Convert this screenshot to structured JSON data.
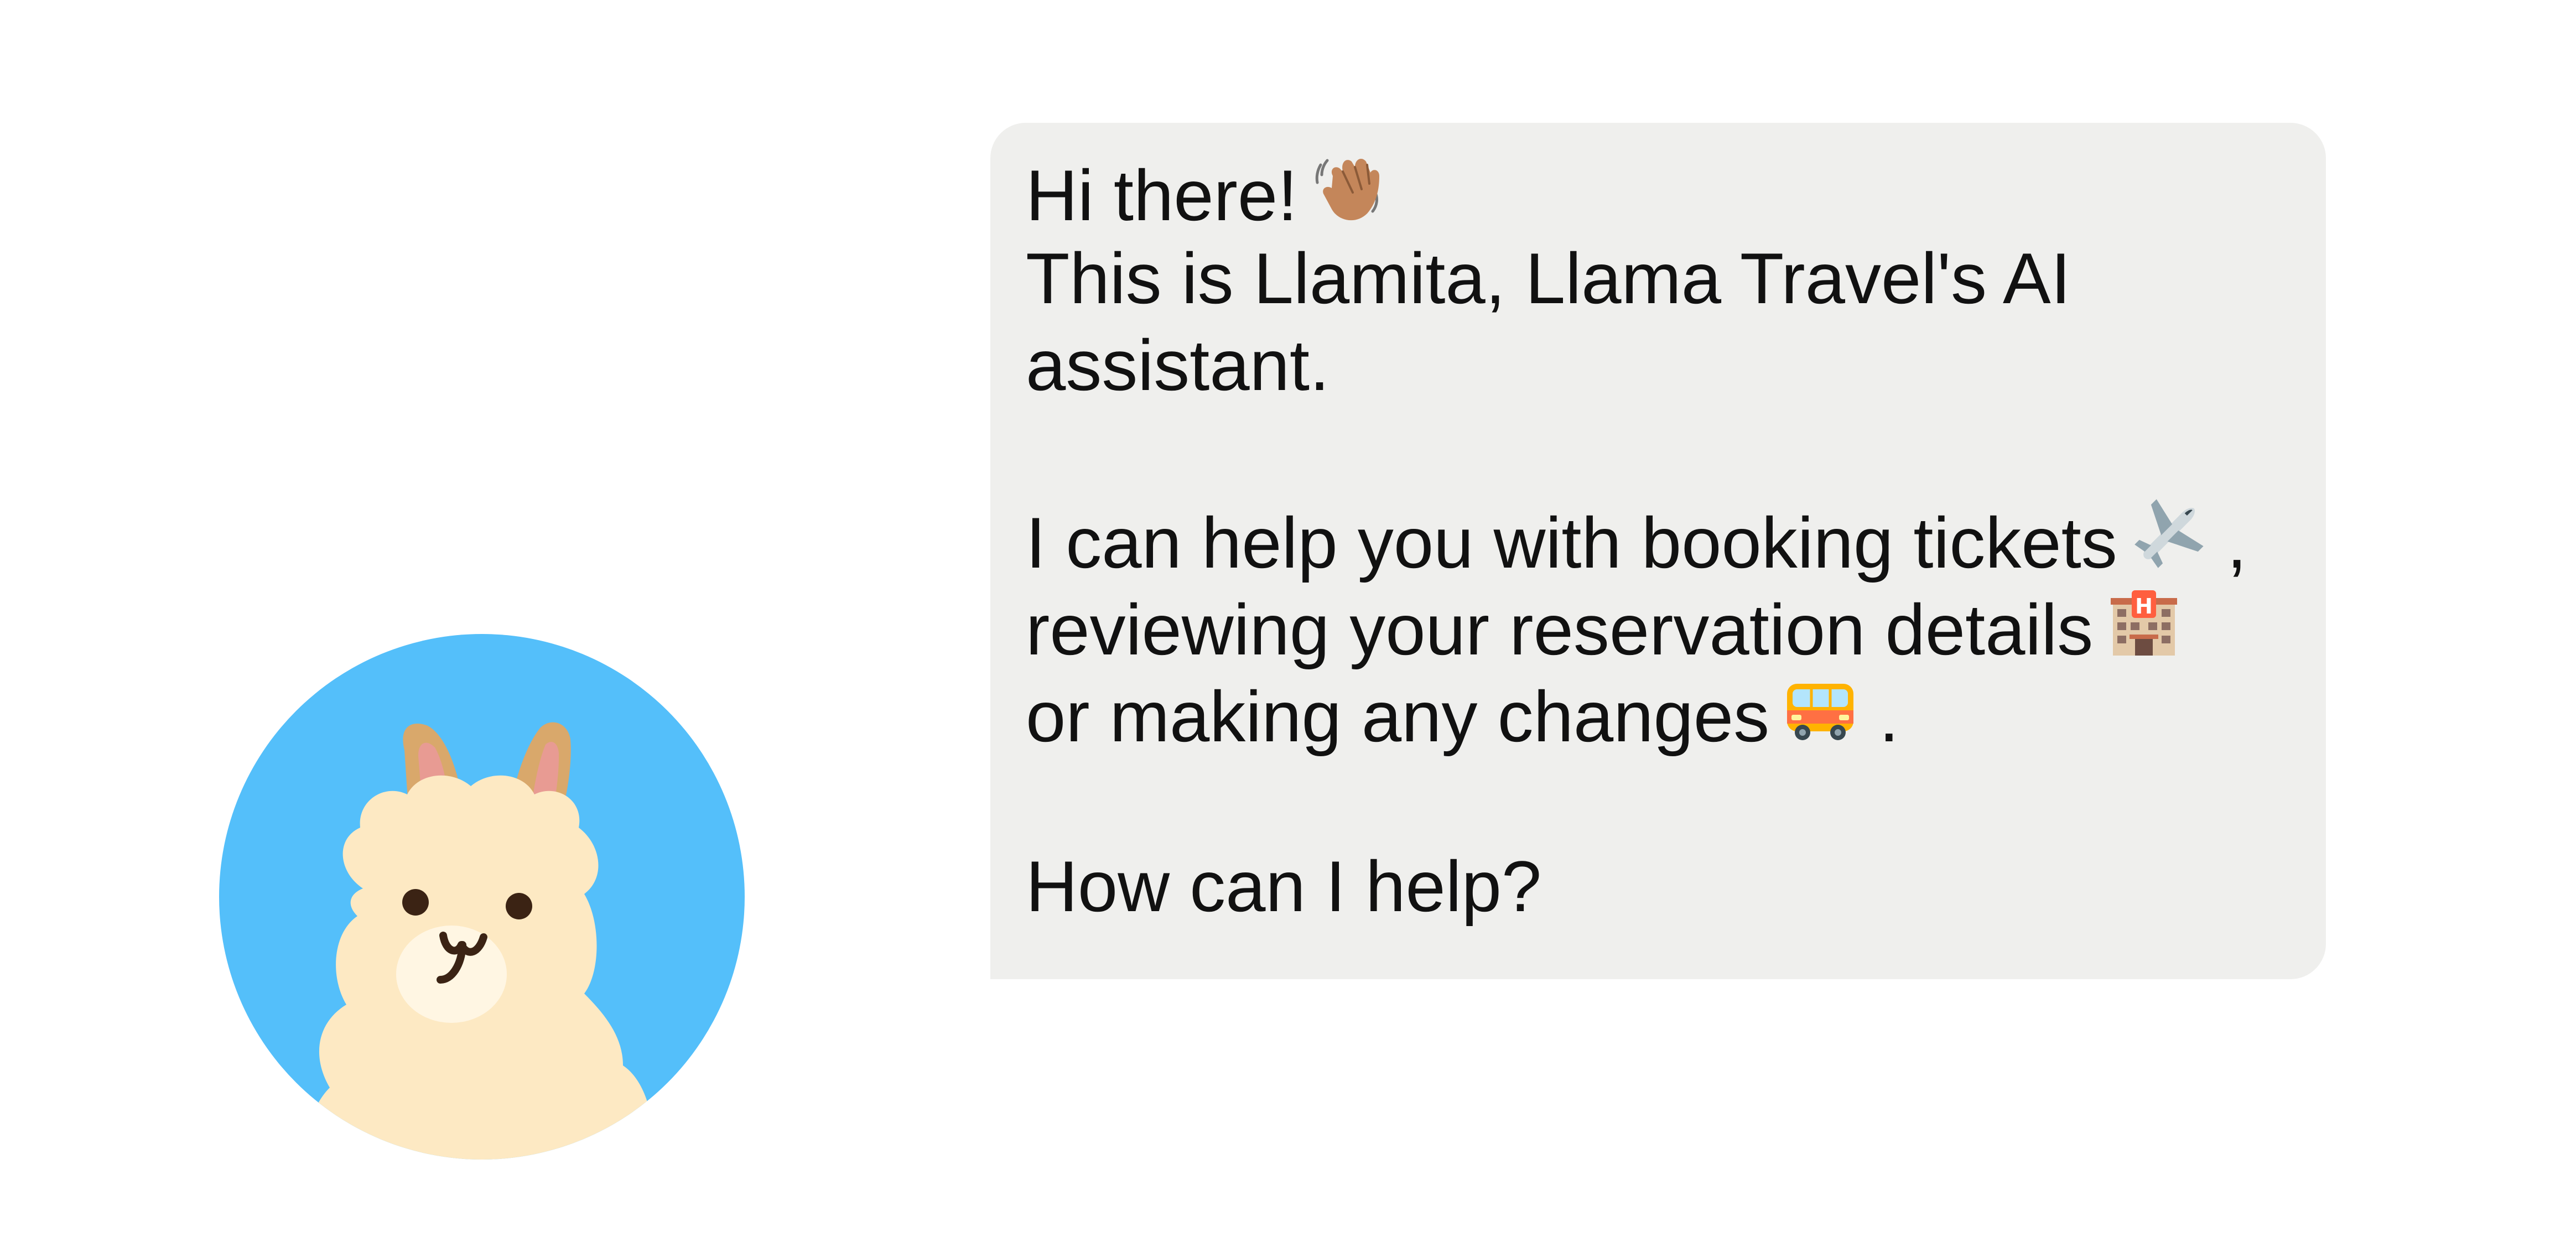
{
  "assistant": {
    "avatar_icon": "llama-avatar-icon",
    "avatar_bg_color": "#54bffa"
  },
  "message": {
    "greeting": "Hi there!",
    "greeting_emoji": "waving-hand-icon",
    "intro_line1": "This is Llamita, Llama Travel's AI",
    "intro_line2": "assistant.",
    "help_line1": "I can help you with booking tickets",
    "help_line1_emoji": "airplane-icon",
    "help_line1_tail": " ,",
    "help_line2": "reviewing your reservation details",
    "help_line2_emoji": "hotel-icon",
    "help_line3": "or making any changes",
    "help_line3_emoji": "minibus-icon",
    "help_line3_tail": " .",
    "question": "How can I help?",
    "bubble_color": "#efefed"
  }
}
